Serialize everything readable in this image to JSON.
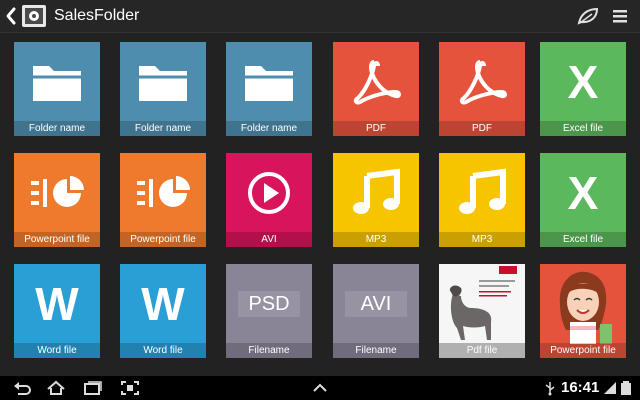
{
  "app": {
    "title": "SalesFolder"
  },
  "colors": {
    "folder": "#4e8dae",
    "pdf": "#e5533d",
    "excel": "#5cb85c",
    "powerpoint": "#f07a2c",
    "avi": "#d8145c",
    "mp3": "#f7c400",
    "word": "#2a9fd6",
    "generic": "#8a8497"
  },
  "tiles": [
    {
      "label": "Folder  name",
      "kind": "folder",
      "icon": "folder-icon"
    },
    {
      "label": "Folder  name",
      "kind": "folder",
      "icon": "folder-icon"
    },
    {
      "label": "Folder  name",
      "kind": "folder",
      "icon": "folder-icon"
    },
    {
      "label": "PDF",
      "kind": "pdf",
      "icon": "pdf-icon"
    },
    {
      "label": "PDF",
      "kind": "pdf",
      "icon": "pdf-icon"
    },
    {
      "label": "Excel file",
      "kind": "excel",
      "icon": "excel-icon",
      "glyph": "X"
    },
    {
      "label": "Powerpoint file",
      "kind": "powerpoint",
      "icon": "powerpoint-icon"
    },
    {
      "label": "Powerpoint file",
      "kind": "powerpoint",
      "icon": "powerpoint-icon"
    },
    {
      "label": "AVI",
      "kind": "avi",
      "icon": "play-icon"
    },
    {
      "label": "MP3",
      "kind": "mp3",
      "icon": "music-note-icon"
    },
    {
      "label": "MP3",
      "kind": "mp3",
      "icon": "music-note-icon"
    },
    {
      "label": "Excel file",
      "kind": "excel",
      "icon": "excel-icon",
      "glyph": "X"
    },
    {
      "label": "Word file",
      "kind": "word",
      "icon": "word-icon",
      "glyph": "W"
    },
    {
      "label": "Word file",
      "kind": "word",
      "icon": "word-icon",
      "glyph": "W"
    },
    {
      "label": "Filename",
      "kind": "generic",
      "icon": "psd-text",
      "glyph": "PSD"
    },
    {
      "label": "Filename",
      "kind": "generic",
      "icon": "avi-text",
      "glyph": "AVI"
    },
    {
      "label": "Pdf file",
      "kind": "thumb-pdf",
      "icon": "pdf-thumbnail"
    },
    {
      "label": "Powerpoint file",
      "kind": "thumb-ppt",
      "icon": "powerpoint-thumbnail"
    }
  ],
  "statusbar": {
    "time": "16:41"
  }
}
